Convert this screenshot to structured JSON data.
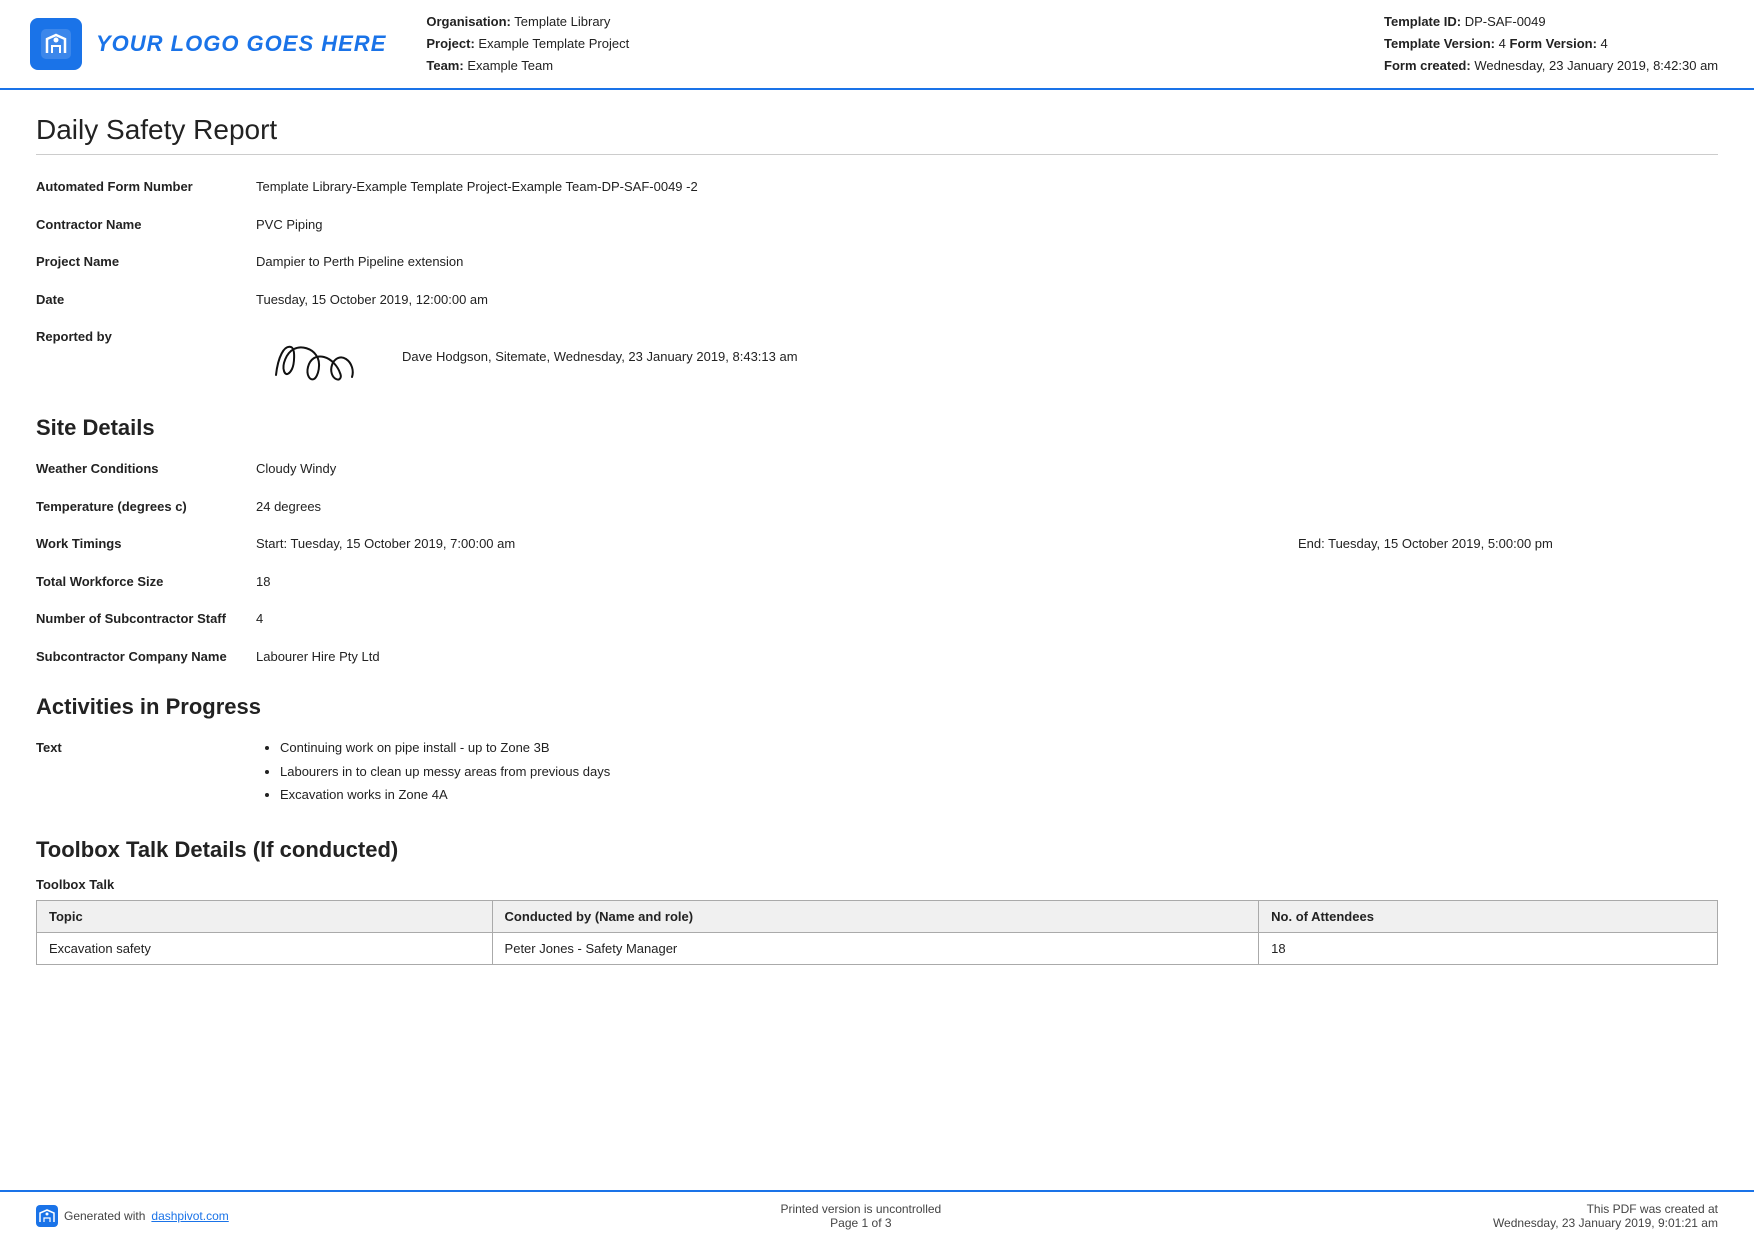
{
  "header": {
    "logo_text": "YOUR LOGO GOES HERE",
    "org_label": "Organisation:",
    "org_value": "Template Library",
    "project_label": "Project:",
    "project_value": "Example Template Project",
    "team_label": "Team:",
    "team_value": "Example Team",
    "template_id_label": "Template ID:",
    "template_id_value": "DP-SAF-0049",
    "template_version_label": "Template Version:",
    "template_version_value": "4",
    "form_version_label": "Form Version:",
    "form_version_value": "4",
    "form_created_label": "Form created:",
    "form_created_value": "Wednesday, 23 January 2019, 8:42:30 am"
  },
  "page": {
    "title": "Daily Safety Report"
  },
  "form_fields": {
    "automated_form_label": "Automated Form Number",
    "automated_form_value": "Template Library-Example Template Project-Example Team-DP-SAF-0049   -2",
    "contractor_label": "Contractor Name",
    "contractor_value": "PVC Piping",
    "project_label": "Project Name",
    "project_value": "Dampier to Perth Pipeline extension",
    "date_label": "Date",
    "date_value": "Tuesday, 15 October 2019, 12:00:00 am",
    "reported_by_label": "Reported by",
    "reported_by_sig_alt": "Signature",
    "reported_by_text": "Dave Hodgson, Sitemate, Wednesday, 23 January 2019, 8:43:13 am"
  },
  "site_details": {
    "heading": "Site Details",
    "weather_label": "Weather Conditions",
    "weather_value": "Cloudy   Windy",
    "temperature_label": "Temperature (degrees c)",
    "temperature_value": "24 degrees",
    "work_timings_label": "Work Timings",
    "work_timings_start": "Start: Tuesday, 15 October 2019, 7:00:00 am",
    "work_timings_end": "End: Tuesday, 15 October 2019, 5:00:00 pm",
    "workforce_label": "Total Workforce Size",
    "workforce_value": "18",
    "subcontractor_staff_label": "Number of Subcontractor Staff",
    "subcontractor_staff_value": "4",
    "subcontractor_company_label": "Subcontractor Company Name",
    "subcontractor_company_value": "Labourer Hire Pty Ltd"
  },
  "activities": {
    "heading": "Activities in Progress",
    "text_label": "Text",
    "items": [
      "Continuing work on pipe install - up to Zone 3B",
      "Labourers in to clean up messy areas from previous days",
      "Excavation works in Zone 4A"
    ]
  },
  "toolbox": {
    "heading": "Toolbox Talk Details (If conducted)",
    "section_label": "Toolbox Talk",
    "table": {
      "columns": [
        "Topic",
        "Conducted by (Name and role)",
        "No. of Attendees"
      ],
      "rows": [
        [
          "Excavation safety",
          "Peter Jones - Safety Manager",
          "18"
        ]
      ]
    }
  },
  "footer": {
    "generated_text": "Generated with",
    "link_text": "dashpivot.com",
    "uncontrolled": "Printed version is uncontrolled",
    "page": "Page 1 of 3",
    "pdf_created": "This PDF was created at",
    "pdf_date": "Wednesday, 23 January 2019, 9:01:21 am"
  }
}
